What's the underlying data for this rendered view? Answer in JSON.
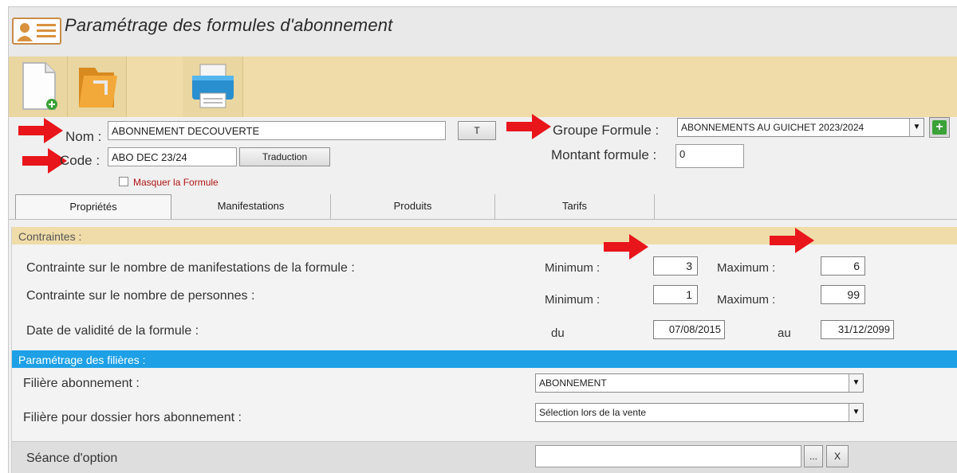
{
  "window": {
    "title": "Paramétrage des formules d'abonnement"
  },
  "toolbar": {
    "items": [
      "new-document-icon",
      "open-folder-icon",
      "printer-icon"
    ]
  },
  "form": {
    "nom_label": "Nom :",
    "nom_value": "ABONNEMENT DECOUVERTE",
    "t_button": "T",
    "code_label": "Code :",
    "code_value": "ABO DEC 23/24",
    "traduction_button": "Traduction",
    "masquer_label": "Masquer la Formule",
    "groupe_label": "Groupe Formule :",
    "groupe_value": "ABONNEMENTS AU GUICHET 2023/2024",
    "montant_label": "Montant formule :",
    "montant_value": "0"
  },
  "tabs": [
    {
      "label": "Propriétés",
      "active": true
    },
    {
      "label": "Manifestations",
      "active": false
    },
    {
      "label": "Produits",
      "active": false
    },
    {
      "label": "Tarifs",
      "active": false
    }
  ],
  "contraintes": {
    "header": "Contraintes :",
    "manifestations_label": "Contrainte sur le nombre de manifestations de la formule :",
    "personnes_label": "Contrainte sur le nombre de personnes :",
    "validite_label": "Date de validité de la formule :",
    "minimum_label": "Minimum :",
    "maximum_label": "Maximum :",
    "du_label": "du",
    "au_label": "au",
    "manif_min": "3",
    "manif_max": "6",
    "pers_min": "1",
    "pers_max": "99",
    "date_du": "07/08/2015",
    "date_au": "31/12/2099"
  },
  "filieres": {
    "header": "Paramétrage des filières :",
    "abonnement_label": "Filière abonnement :",
    "abonnement_value": "ABONNEMENT",
    "hors_label": "Filière pour dossier hors abonnement :",
    "hors_value": "Sélection lors de la vente"
  },
  "option": {
    "label": "Séance d'option",
    "value": "",
    "browse_button": "...",
    "clear_button": "X"
  },
  "colors": {
    "toolbar_bg": "#efdca8",
    "section_blue": "#1da0e6",
    "annotation_arrow": "#e8151b",
    "add_green": "#3aa237"
  }
}
